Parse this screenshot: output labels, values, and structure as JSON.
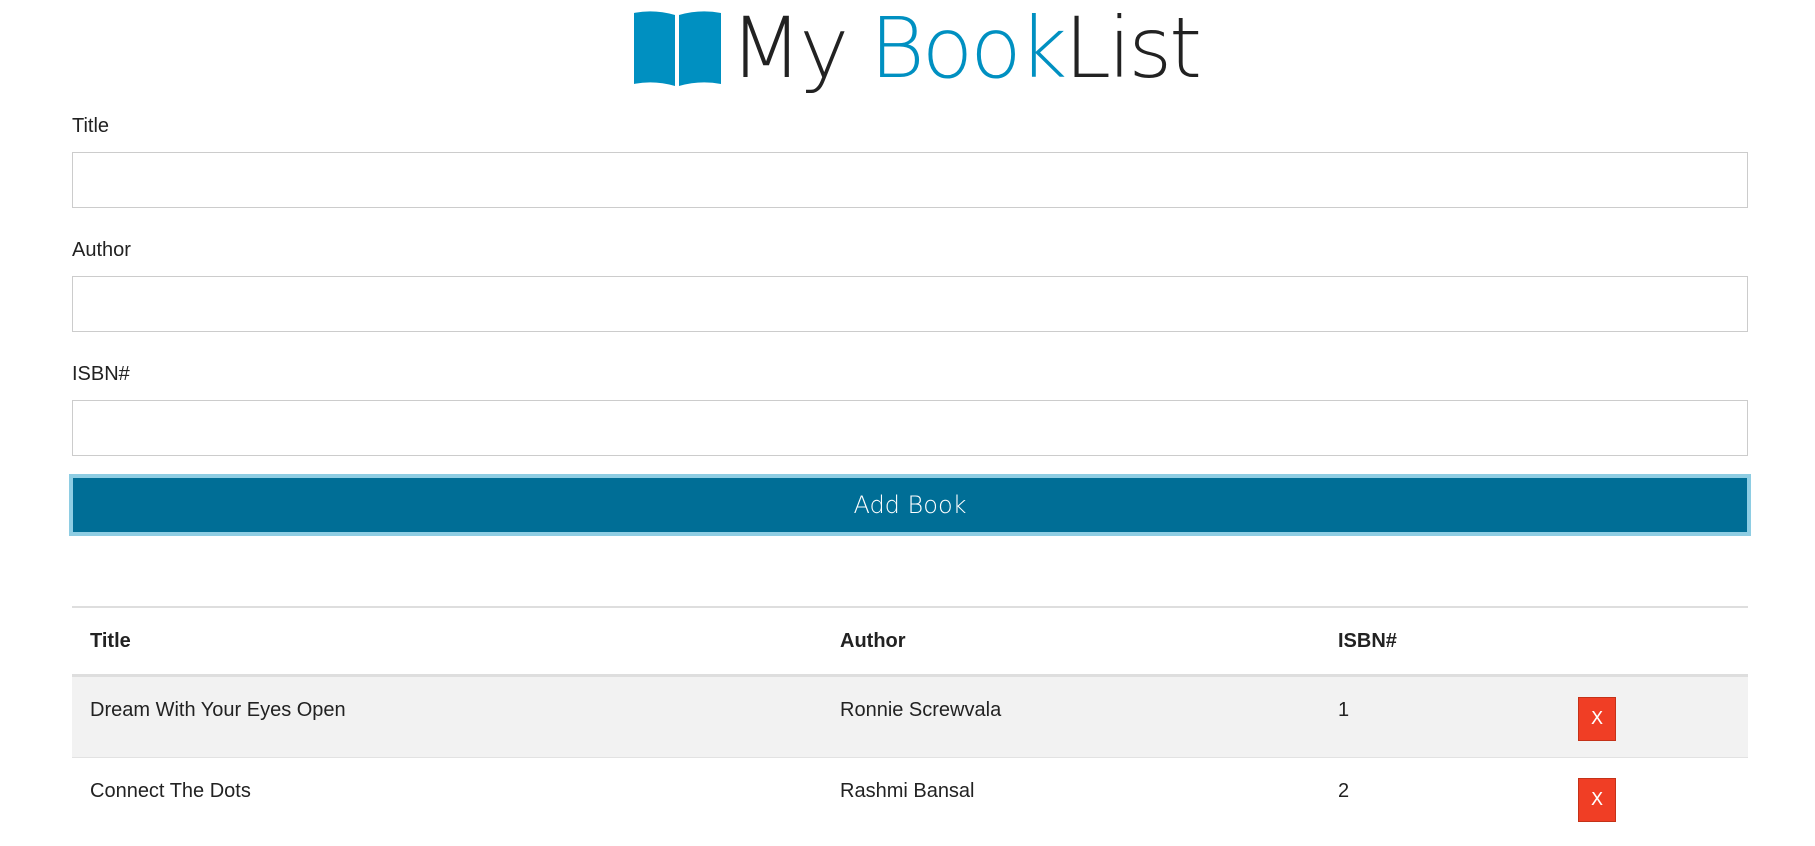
{
  "header": {
    "logo_my": "My ",
    "logo_book": "Book",
    "logo_list": "List",
    "icon": "open-book-icon",
    "brand_color": "#0090c1"
  },
  "form": {
    "title_label": "Title",
    "title_value": "",
    "author_label": "Author",
    "author_value": "",
    "isbn_label": "ISBN#",
    "isbn_value": "",
    "submit_label": "Add Book",
    "submit_color": "#006e96"
  },
  "table": {
    "columns": [
      "Title",
      "Author",
      "ISBN#"
    ],
    "rows": [
      {
        "title": "Dream With Your Eyes Open",
        "author": "Ronnie Screwvala",
        "isbn": "1",
        "delete_label": "X"
      },
      {
        "title": "Connect The Dots",
        "author": "Rashmi Bansal",
        "isbn": "2",
        "delete_label": "X"
      }
    ],
    "delete_color": "#f03e25"
  }
}
